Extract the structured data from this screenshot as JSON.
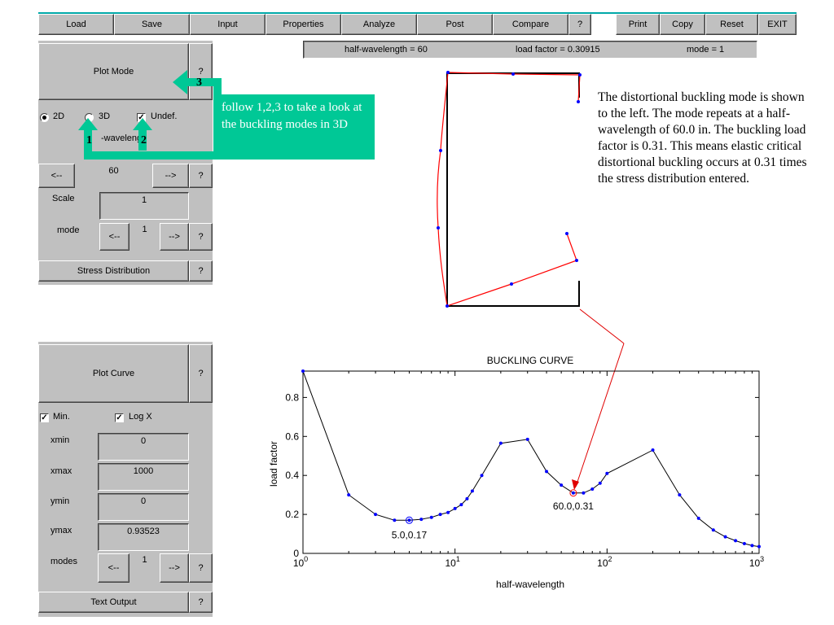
{
  "menu": [
    "Load",
    "Save",
    "Input",
    "Properties",
    "Analyze",
    "Post",
    "Compare",
    "?"
  ],
  "menu_right": [
    "Print",
    "Copy",
    "Reset",
    "EXIT"
  ],
  "status": {
    "half_wavelength": "half-wavelength = 60",
    "load_factor": "load factor = 0.30915",
    "mode": "mode = 1"
  },
  "left_panel": {
    "plot_mode": "Plot Mode",
    "help": "?",
    "opt_2d": "2D",
    "opt_3d": "3D",
    "undef": "Undef.",
    "half_wavelength_label": "-waveleng",
    "hw_value": "60",
    "prev": "<--",
    "next": "-->",
    "scale_label": "Scale",
    "scale_value": "1",
    "mode_label": "mode",
    "mode_value": "1",
    "stress_distribution": "Stress Distribution",
    "plot_curve": "Plot Curve",
    "min": "Min.",
    "logx": "Log X",
    "xmin_label": "xmin",
    "xmin": "0",
    "xmax_label": "xmax",
    "xmax": "1000",
    "ymin_label": "ymin",
    "ymin": "0",
    "ymax_label": "ymax",
    "ymax": "0.93523",
    "modes_label": "modes",
    "modes_value": "1",
    "text_output": "Text Output"
  },
  "callouts": {
    "steps": [
      "1",
      "2",
      "3"
    ],
    "instruction": "follow 1,2,3 to take a look at the buckling modes in 3D",
    "explanation": "The distortional buckling mode is shown to the left. The mode repeats at a half-wavelength of 60.0 in. The buckling load factor is 0.31. This means elastic critical distortional buckling occurs at 0.31 times the stress distribution entered."
  },
  "colors": {
    "panel": "#c0c0c0",
    "teal": "#00c896",
    "curve": "#000000",
    "points": "#0000ff",
    "deformed": "#ff0000",
    "arrow": "#e00000"
  },
  "chart_data": {
    "type": "line",
    "title": "BUCKLING CURVE",
    "xlabel": "half-wavelength",
    "ylabel": "load factor",
    "xscale": "log",
    "xlim": [
      1,
      1000
    ],
    "ylim": [
      0,
      0.93523
    ],
    "xticks": [
      "10^0",
      "10^1",
      "10^2",
      "10^3"
    ],
    "yticks": [
      "0",
      "0.2",
      "0.4",
      "0.6",
      "0.8"
    ],
    "x": [
      1,
      2,
      3,
      4,
      5,
      6,
      7,
      8,
      9,
      10,
      11,
      12,
      13,
      15,
      20,
      30,
      40,
      50,
      60,
      70,
      80,
      90,
      100,
      200,
      300,
      400,
      500,
      600,
      700,
      800,
      900,
      1000
    ],
    "y": [
      0.935,
      0.3,
      0.2,
      0.17,
      0.17,
      0.175,
      0.185,
      0.2,
      0.21,
      0.23,
      0.25,
      0.28,
      0.32,
      0.4,
      0.565,
      0.585,
      0.42,
      0.35,
      0.31,
      0.31,
      0.33,
      0.36,
      0.41,
      0.53,
      0.3,
      0.18,
      0.12,
      0.085,
      0.065,
      0.05,
      0.04,
      0.035
    ],
    "annotations": [
      {
        "x": 5,
        "y": 0.17,
        "label": "5.0,0.17"
      },
      {
        "x": 60,
        "y": 0.31,
        "label": "60.0,0.31"
      }
    ]
  }
}
